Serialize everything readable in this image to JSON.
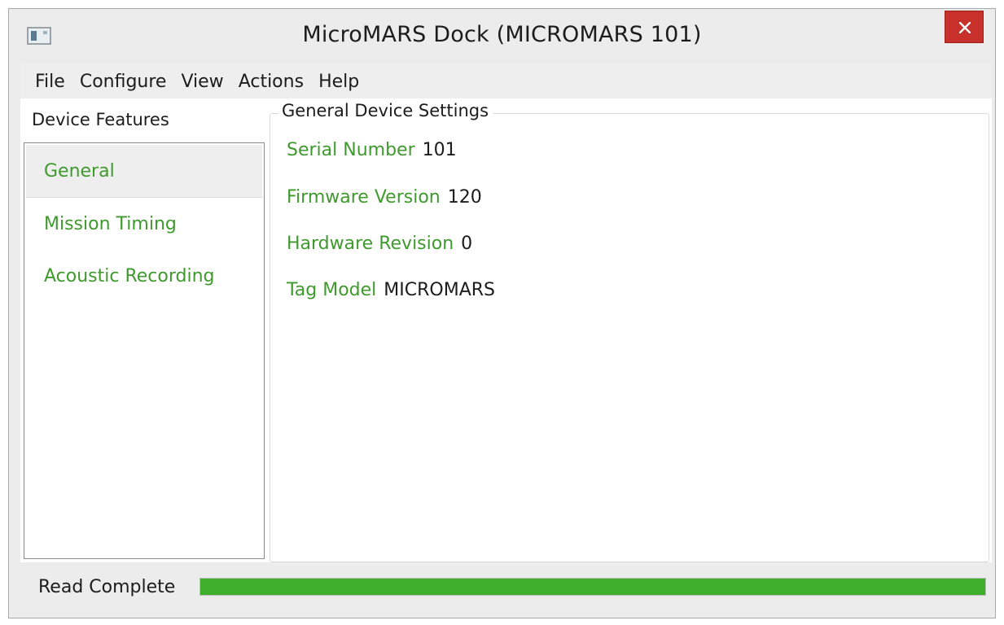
{
  "window": {
    "title": "MicroMARS Dock (MICROMARS 101)",
    "close_icon": "close-icon",
    "app_icon": "app-window-icon"
  },
  "menu": {
    "items": [
      {
        "label": "File"
      },
      {
        "label": "Configure"
      },
      {
        "label": "View"
      },
      {
        "label": "Actions"
      },
      {
        "label": "Help"
      }
    ]
  },
  "sidebar": {
    "header": "Device Features",
    "items": [
      {
        "label": "General",
        "selected": true
      },
      {
        "label": "Mission Timing",
        "selected": false
      },
      {
        "label": "Acoustic Recording",
        "selected": false
      }
    ]
  },
  "settings": {
    "group_title": "General Device Settings",
    "rows": [
      {
        "label": "Serial Number",
        "value": "101"
      },
      {
        "label": "Firmware Version",
        "value": "120"
      },
      {
        "label": "Hardware Revision",
        "value": "0"
      },
      {
        "label": "Tag Model",
        "value": "MICROMARS"
      }
    ]
  },
  "status": {
    "text": "Read Complete",
    "progress": 1.0
  },
  "colors": {
    "accent_green": "#3f9a2d",
    "progress_green": "#3eae2b",
    "close_red": "#c7302b"
  }
}
